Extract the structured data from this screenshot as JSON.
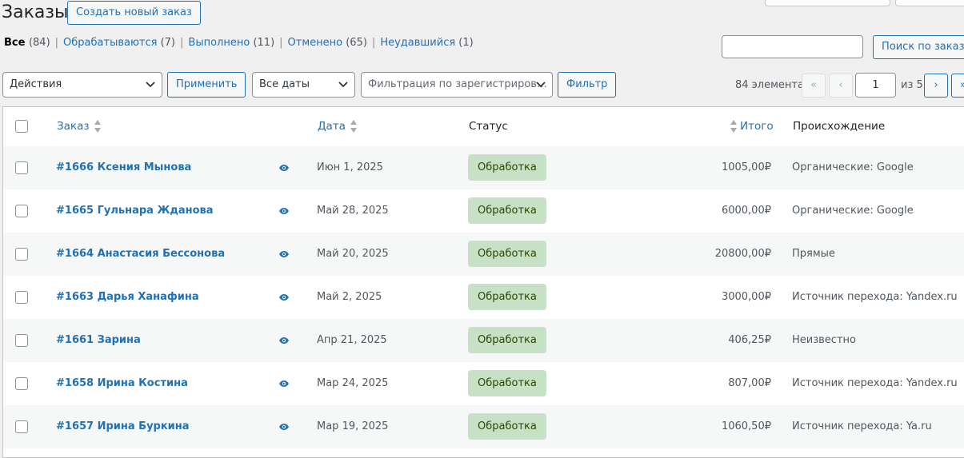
{
  "header": {
    "title": "Заказы",
    "create_label": "Создать новый заказ"
  },
  "views": [
    {
      "label": "Все",
      "count": "(84)",
      "current": true
    },
    {
      "label": "Обрабатываются",
      "count": "(7)"
    },
    {
      "label": "Выполнено",
      "count": "(11)"
    },
    {
      "label": "Отменено",
      "count": "(65)"
    },
    {
      "label": "Неудавшийся",
      "count": "(1)"
    }
  ],
  "search": {
    "value": "",
    "button_label": "Поиск по заказам"
  },
  "bulk": {
    "selected": "Действия",
    "apply_label": "Применить"
  },
  "filters": {
    "date_selected": "Все даты",
    "customer_placeholder": "Фильтрация по зарегистриров…",
    "filter_label": "Фильтр"
  },
  "pagination": {
    "items": "84 элемента",
    "first": "«",
    "prev": "‹",
    "current_page": "1",
    "of_label": "из 5",
    "next": "›",
    "last": "»"
  },
  "table": {
    "columns": {
      "order": "Заказ",
      "date": "Дата",
      "status": "Статус",
      "total": "Итого",
      "origin": "Происхождение"
    },
    "rows": [
      {
        "order": "#1666 Ксения Мынова",
        "date": "Июн 1, 2025",
        "status": "Обработка",
        "total": "1005,00₽",
        "origin": "Органические: Google"
      },
      {
        "order": "#1665 Гульнара Жданова",
        "date": "Май 28, 2025",
        "status": "Обработка",
        "total": "6000,00₽",
        "origin": "Органические: Google"
      },
      {
        "order": "#1664 Анастасия Бессонова",
        "date": "Май 20, 2025",
        "status": "Обработка",
        "total": "20800,00₽",
        "origin": "Прямые"
      },
      {
        "order": "#1663 Дарья Ханафина",
        "date": "Май 2, 2025",
        "status": "Обработка",
        "total": "3000,00₽",
        "origin": "Источник перехода: Yandex.ru"
      },
      {
        "order": "#1661 Зарина",
        "date": "Апр 21, 2025",
        "status": "Обработка",
        "total": "406,25₽",
        "origin": "Неизвестно"
      },
      {
        "order": "#1658 Ирина Костина",
        "date": "Мар 24, 2025",
        "status": "Обработка",
        "total": "807,00₽",
        "origin": "Источник перехода: Yandex.ru"
      },
      {
        "order": "#1657 Ирина Буркина",
        "date": "Мар 19, 2025",
        "status": "Обработка",
        "total": "1060,50₽",
        "origin": "Источник перехода: Ya.ru"
      }
    ]
  },
  "colors": {
    "link": "#2271b1",
    "status_processing_bg": "#c6e1c6",
    "status_processing_text": "#2c4700",
    "page_bg": "#f0f0f1"
  }
}
